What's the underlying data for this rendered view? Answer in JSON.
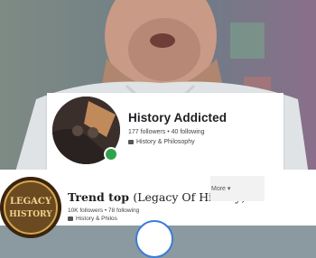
{
  "card1": {
    "name": "History Addicted",
    "stats": "177 followers • 40 following",
    "category": "History & Philosophy"
  },
  "card2": {
    "name": "Trend top",
    "name_suffix": "(Legacy Of History)",
    "stats": "10K followers • 78 following",
    "category": "History & Philos",
    "avatar_text_line1": "LEGACY",
    "avatar_text_line2": "HISTORY"
  },
  "more_label": "More ▾",
  "colors": {
    "online": "#31a24c",
    "accent": "#3b7bd8"
  }
}
